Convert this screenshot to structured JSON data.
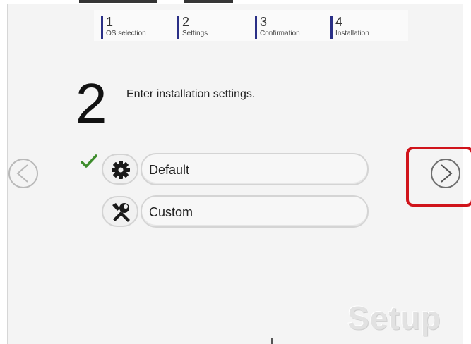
{
  "steps": [
    {
      "number": "1",
      "label": "OS selection"
    },
    {
      "number": "2",
      "label": "Settings"
    },
    {
      "number": "3",
      "label": "Confirmation"
    },
    {
      "number": "4",
      "label": "Installation"
    }
  ],
  "current_step": {
    "number": "2",
    "heading": "Enter installation settings."
  },
  "options": {
    "default": {
      "label": "Default",
      "icon": "gear-icon",
      "selected": true
    },
    "custom": {
      "label": "Custom",
      "icon": "tools-icon",
      "selected": false
    }
  },
  "navigation": {
    "prev_icon": "chevron-left-icon",
    "next_icon": "chevron-right-icon"
  },
  "watermark": "Setup",
  "colors": {
    "step_marker": "#2a2f86",
    "check": "#3d8c2c",
    "highlight": "#d0141b"
  }
}
